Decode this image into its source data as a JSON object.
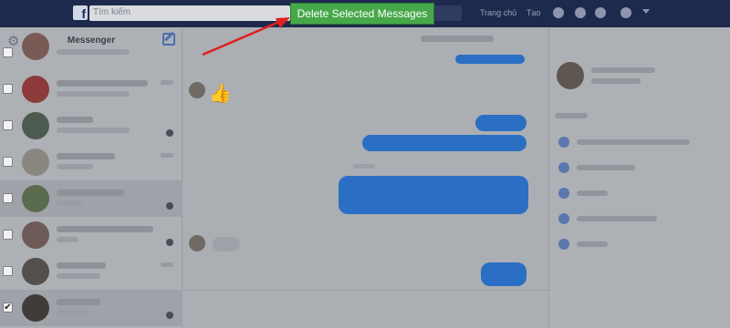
{
  "topbar": {
    "search_placeholder": "Tìm kiếm",
    "link_home": "Trang chủ",
    "link_create": "Tạo"
  },
  "extension": {
    "delete_button_label": "Delete Selected Messages"
  },
  "sidebar": {
    "title": "Messenger",
    "conversations": [
      {
        "checked": false,
        "selected": false,
        "avatar_color": "#7a5a55"
      },
      {
        "checked": false,
        "selected": false,
        "avatar_color": "#8c3a3a"
      },
      {
        "checked": false,
        "selected": false,
        "avatar_color": "#4d5a4f"
      },
      {
        "checked": false,
        "selected": false,
        "avatar_color": "#8a8780"
      },
      {
        "checked": false,
        "selected": true,
        "avatar_color": "#5b6b4e"
      },
      {
        "checked": false,
        "selected": false,
        "avatar_color": "#6e5b58"
      },
      {
        "checked": false,
        "selected": false,
        "avatar_color": "#55504d"
      },
      {
        "checked": true,
        "selected": true,
        "avatar_color": "#3f3c3a"
      }
    ]
  },
  "colors": {
    "accent_green": "#46a84a",
    "arrow_red": "#e02020",
    "bubble_blue": "#2a6fc4",
    "topbar_bg": "#1d2a4d"
  },
  "icons": {
    "settings": "gear-icon",
    "compose": "compose-icon",
    "like": "thumbs-up-icon",
    "checkmark": "check-icon"
  }
}
